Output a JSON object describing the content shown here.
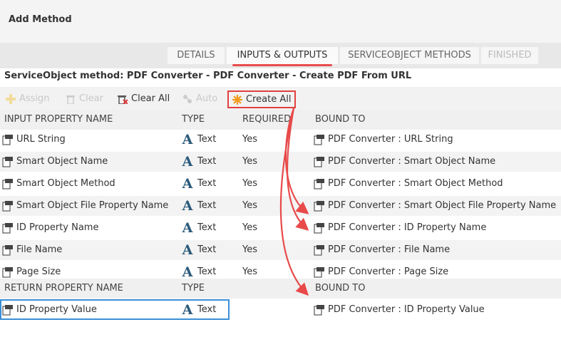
{
  "header": {
    "title": "Add Method"
  },
  "wizard": {
    "steps": [
      {
        "label": "DETAILS",
        "state": "done"
      },
      {
        "label": "INPUTS & OUTPUTS",
        "state": "active"
      },
      {
        "label": "SERVICEOBJECT METHODS",
        "state": "normal"
      },
      {
        "label": "FINISHED",
        "state": "disabled"
      }
    ],
    "active_color": "#e84c4c"
  },
  "subtitle": "ServiceObject method: PDF Converter - PDF Converter - Create PDF From URL",
  "toolbar": {
    "assign": "Assign",
    "clear": "Clear",
    "clear_all": "Clear All",
    "auto": "Auto",
    "create_all": "Create All"
  },
  "inputs_header": {
    "name": "INPUT PROPERTY NAME",
    "type": "TYPE",
    "required": "REQUIRED",
    "bound": "BOUND TO"
  },
  "inputs": [
    {
      "name": "URL String",
      "type": "Text",
      "required": "Yes",
      "bound": "PDF Converter : URL String"
    },
    {
      "name": "Smart Object Name",
      "type": "Text",
      "required": "Yes",
      "bound": "PDF Converter : Smart Object Name"
    },
    {
      "name": "Smart Object Method",
      "type": "Text",
      "required": "Yes",
      "bound": "PDF Converter : Smart Object Method"
    },
    {
      "name": "Smart Object File Property Name",
      "type": "Text",
      "required": "Yes",
      "bound": "PDF Converter : Smart Object File Property Name"
    },
    {
      "name": "ID Property Name",
      "type": "Text",
      "required": "Yes",
      "bound": "PDF Converter : ID Property Name"
    },
    {
      "name": "File Name",
      "type": "Text",
      "required": "Yes",
      "bound": "PDF Converter : File Name"
    },
    {
      "name": "Page Size",
      "type": "Text",
      "required": "Yes",
      "bound": "PDF Converter : Page Size"
    }
  ],
  "returns_header": {
    "name": "RETURN PROPERTY NAME",
    "type": "TYPE",
    "bound": "BOUND TO"
  },
  "returns": [
    {
      "name": "ID Property Value",
      "type": "Text",
      "bound": "PDF Converter : ID Property Value"
    }
  ],
  "colors": {
    "highlight_red": "#e34040",
    "highlight_blue": "#3a8fd8",
    "type_icon": "#2a5a7a"
  }
}
